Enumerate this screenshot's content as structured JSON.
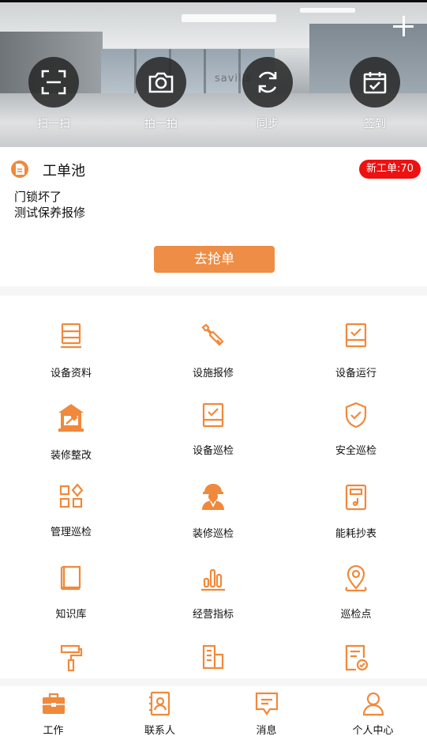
{
  "colors": {
    "accent": "#f0893b",
    "badge_red": "#ee1111",
    "button_orange": "#ee8d45",
    "text": "#111111"
  },
  "hero": {
    "banner_sign": "savills",
    "plus_icon": "plus-icon",
    "actions": [
      {
        "label": "扫一扫",
        "icon": "scan-icon"
      },
      {
        "label": "拍一拍",
        "icon": "camera-icon"
      },
      {
        "label": "同步",
        "icon": "sync-icon"
      },
      {
        "label": "签到",
        "icon": "calendar-check-icon"
      }
    ]
  },
  "pool": {
    "title": "工单池",
    "new_badge": "新工单:70",
    "items": [
      "门锁坏了",
      "测试保养报修"
    ],
    "grab_button": "去抢单"
  },
  "grid": {
    "items": [
      {
        "label": "设备资料",
        "icon": "server-doc-icon"
      },
      {
        "label": "设施报修",
        "icon": "wrench-icon"
      },
      {
        "label": "设备运行",
        "icon": "monitor-check-icon"
      },
      {
        "label": "装修整改",
        "icon": "renovation-icon"
      },
      {
        "label": "设备巡检",
        "icon": "inspection-check-icon"
      },
      {
        "label": "安全巡检",
        "icon": "shield-check-icon"
      },
      {
        "label": "管理巡检",
        "icon": "apps-icon"
      },
      {
        "label": "装修巡检",
        "icon": "worker-icon"
      },
      {
        "label": "能耗抄表",
        "icon": "meter-icon"
      },
      {
        "label": "知识库",
        "icon": "book-icon"
      },
      {
        "label": "经营指标",
        "icon": "bar-chart-icon"
      },
      {
        "label": "巡检点",
        "icon": "location-pin-icon"
      },
      {
        "label": "",
        "icon": "paint-roller-icon"
      },
      {
        "label": "",
        "icon": "building-icon"
      },
      {
        "label": "",
        "icon": "form-check-icon"
      }
    ]
  },
  "nav": {
    "tabs": [
      {
        "label": "工作",
        "icon": "briefcase-icon",
        "active": true
      },
      {
        "label": "联系人",
        "icon": "contacts-icon",
        "active": false
      },
      {
        "label": "消息",
        "icon": "message-icon",
        "active": false
      },
      {
        "label": "个人中心",
        "icon": "user-icon",
        "active": false
      }
    ]
  }
}
